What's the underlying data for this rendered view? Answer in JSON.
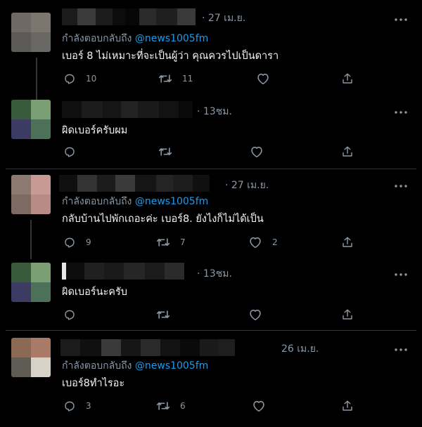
{
  "colors": {
    "background": "#000000",
    "text": "#e7e9ea",
    "muted": "#8b98a5",
    "link": "#1d9bf0",
    "divider": "#2f3336"
  },
  "tweets": [
    {
      "time": "· 27 เม.ย.",
      "reply_label": "กำลังตอบกลับถึง",
      "reply_handle": "@news1005fm",
      "text": "เบอร์ 8 ไม่เหมาะที่จะเป็นผู้ว่า คุณควรไปเป็นดารา",
      "reply_count": "10",
      "retweet_count": "11",
      "like_count": "",
      "avatar_colors": [
        "#6e6a63",
        "#7b776f",
        "#5b5a56",
        "#6a6864"
      ]
    },
    {
      "time": "· 13ชม.",
      "text": "ผิดเบอร์ครับผม",
      "reply_count": "",
      "retweet_count": "",
      "like_count": "",
      "avatar_colors": [
        "#3a5a3c",
        "#7b9e74",
        "#3b3b63",
        "#4d7058"
      ]
    },
    {
      "time": "· 27 เม.ย.",
      "reply_label": "กำลังตอบกลับถึง",
      "reply_handle": "@news1005fm",
      "text": "กลับบ้านไปพักเถอะค่ะ เบอร์8. ยังไงก็ไม่ได้เป็น",
      "reply_count": "9",
      "retweet_count": "7",
      "like_count": "2",
      "avatar_colors": [
        "#8c7a70",
        "#c79a94",
        "#7d6a63",
        "#b98b86"
      ]
    },
    {
      "time": "· 13ชม.",
      "text": "ผิดเบอร์นะครับ",
      "reply_count": "",
      "retweet_count": "",
      "like_count": "",
      "avatar_colors": [
        "#3a5a3c",
        "#7b9e74",
        "#3b3b63",
        "#4d7058"
      ]
    },
    {
      "time": "26 เม.ย.",
      "reply_label": "กำลังตอบกลับถึง",
      "reply_handle": "@news1005fm",
      "text": "เบอร์8ทำไรอะ",
      "reply_count": "3",
      "retweet_count": "6",
      "like_count": "",
      "avatar_colors": [
        "#8a6a55",
        "#a97a68",
        "#5f5c55",
        "#d6d2c8"
      ]
    }
  ]
}
